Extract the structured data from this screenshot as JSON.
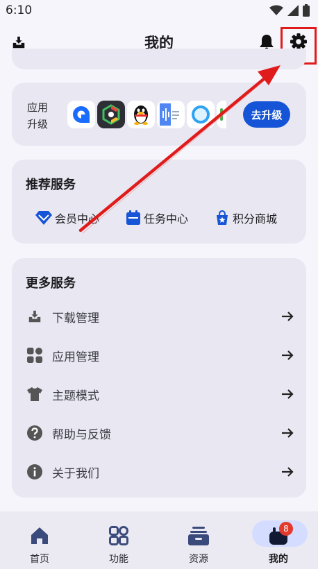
{
  "status_bar": {
    "time": "6:10"
  },
  "header": {
    "title": "我的"
  },
  "upgrade": {
    "label_line1": "应用",
    "label_line2": "升级",
    "button_label": "去升级"
  },
  "recommend": {
    "title": "推荐服务",
    "items": [
      {
        "label": "会员中心",
        "icon": "diamond-icon"
      },
      {
        "label": "任务中心",
        "icon": "calendar-icon"
      },
      {
        "label": "积分商城",
        "icon": "shop-star-icon"
      }
    ]
  },
  "more": {
    "title": "更多服务",
    "items": [
      {
        "label": "下载管理",
        "icon": "download-tray-icon"
      },
      {
        "label": "应用管理",
        "icon": "apps-grid-icon"
      },
      {
        "label": "主题模式",
        "icon": "tshirt-icon"
      },
      {
        "label": "帮助与反馈",
        "icon": "help-icon"
      },
      {
        "label": "关于我们",
        "icon": "info-icon"
      }
    ]
  },
  "nav": {
    "items": [
      {
        "label": "首页",
        "icon": "home-icon"
      },
      {
        "label": "功能",
        "icon": "function-icon"
      },
      {
        "label": "资源",
        "icon": "resource-icon"
      },
      {
        "label": "我的",
        "icon": "profile-icon"
      }
    ],
    "badge": "8"
  },
  "colors": {
    "accent": "#1554d6",
    "highlight": "#e01b1b",
    "card": "#e9e8f2"
  }
}
